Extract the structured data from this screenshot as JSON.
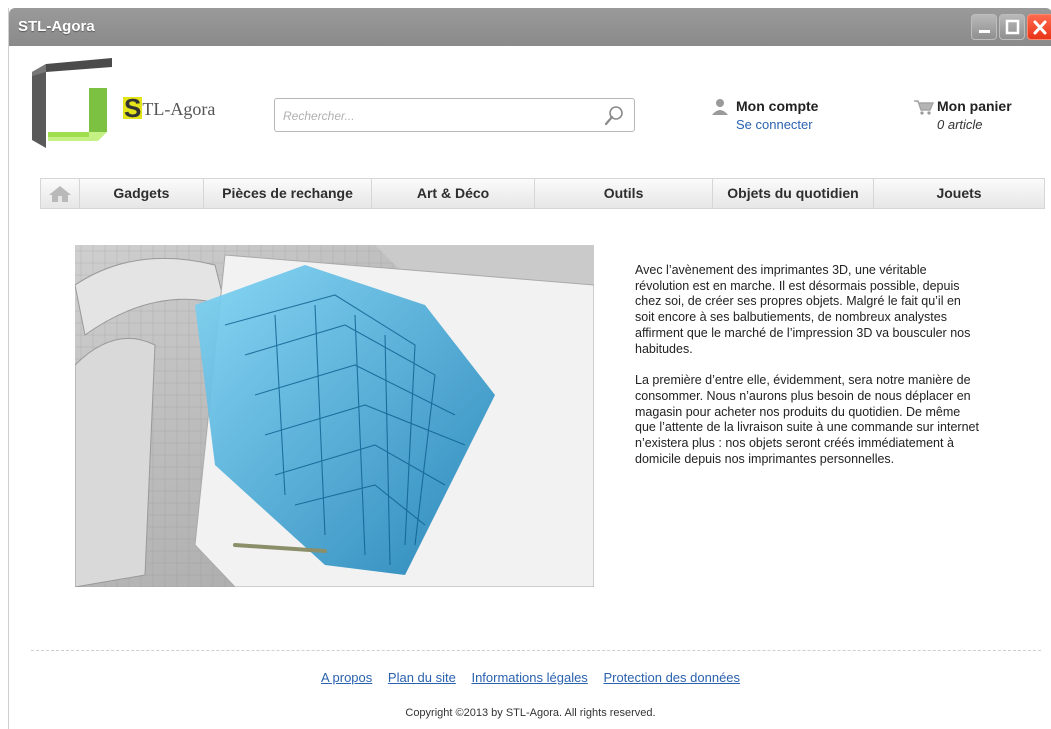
{
  "window": {
    "title": "STL-Agora"
  },
  "header": {
    "brand_initial": "S",
    "brand_rest": "TL-Agora",
    "search_placeholder": "Rechercher...",
    "account": {
      "label": "Mon compte",
      "link": "Se connecter",
      "icon": "user-icon"
    },
    "cart": {
      "label": "Mon panier",
      "count": "0 article",
      "icon": "cart-icon"
    }
  },
  "nav": {
    "home_icon": "home-icon",
    "items": [
      {
        "label": "Gadgets"
      },
      {
        "label": "Pièces de rechange"
      },
      {
        "label": "Art & Déco"
      },
      {
        "label": "Outils"
      },
      {
        "label": "Objets du quotidien"
      },
      {
        "label": "Jouets"
      }
    ]
  },
  "article": {
    "paragraphs": [
      "Avec l’avènement des imprimantes 3D, une véritable révolution est en marche. Il est désormais possible, depuis chez soi, de créer ses propres objets. Malgré le fait qu’il en soit encore à ses balbutiements, de nombreux analystes affirment que le marché de l’impression 3D va bousculer nos habitudes.",
      "La première d’entre elle, évidemment, sera notre manière de consommer. Nous n’aurons plus besoin de nous déplacer en magasin pour acheter nos produits du quotidien. De même que l’attente de la livraison suite à une commande sur internet n’existera plus : nos objets seront créés immédiatement à domicile depuis nos imprimantes personnelles."
    ]
  },
  "footer": {
    "links": [
      "A propos",
      "Plan du site",
      "Informations légales",
      "Protection des données"
    ],
    "copyright": "Copyright ©2013 by STL-Agora. All rights reserved."
  },
  "colors": {
    "titlebar": "#8f8f8f",
    "close": "#e93418",
    "link": "#2a62b0",
    "brand_highlight": "#e3e41a",
    "logo_green": "#7dc142",
    "hero_blue": "#2aa9e0"
  }
}
